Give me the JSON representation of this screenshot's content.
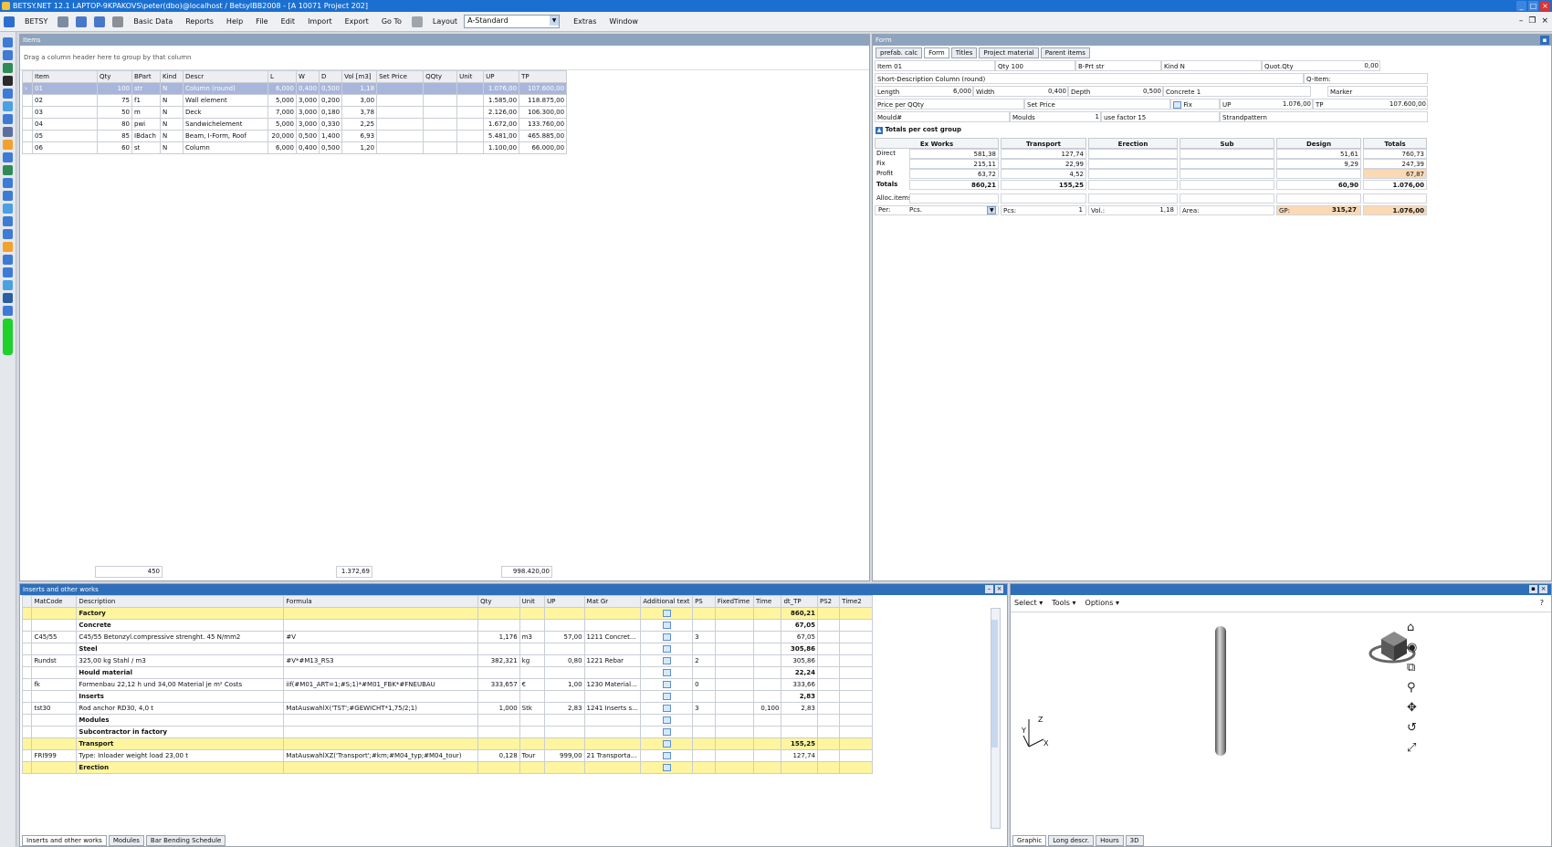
{
  "app": {
    "title": "BETSY.NET 12.1  LAPTOP-9KPAKOVS\\peter(dbo)@localhost / BetsyIBB2008 - [A 10071 Project 202]",
    "brand_color": "#1b6fd1"
  },
  "menu": {
    "items": [
      "BETSY",
      "Basic Data",
      "Reports",
      "Help",
      "File",
      "Edit",
      "Import",
      "Export",
      "Go To",
      "Layout",
      "Extras",
      "Window"
    ],
    "layout_value": "A-Standard"
  },
  "items_panel": {
    "title": "Items",
    "group_hint": "Drag a column header here to group by that column",
    "columns": [
      "Item",
      "Qty",
      "BPart",
      "Kind",
      "Descr",
      "L",
      "W",
      "D",
      "Vol [m3]",
      "Set Price",
      "QQty",
      "Unit",
      "UP",
      "TP"
    ],
    "rows": [
      [
        "01",
        "100",
        "str",
        "N",
        "Column (round)",
        "6,000",
        "0,400",
        "0,500",
        "1,18",
        "",
        "",
        "",
        "1.076,00",
        "107.600,00"
      ],
      [
        "02",
        "75",
        "f1",
        "N",
        "Wall element",
        "5,000",
        "3,000",
        "0,200",
        "3,00",
        "",
        "",
        "",
        "1.585,00",
        "118.875,00"
      ],
      [
        "03",
        "50",
        "m",
        "N",
        "Deck",
        "7,000",
        "3,000",
        "0,180",
        "3,78",
        "",
        "",
        "",
        "2.126,00",
        "106.300,00"
      ],
      [
        "04",
        "80",
        "pwi",
        "N",
        "Sandwichelement",
        "5,000",
        "3,000",
        "0,330",
        "2,25",
        "",
        "",
        "",
        "1.672,00",
        "133.760,00"
      ],
      [
        "05",
        "85",
        "IBdach",
        "N",
        "Beam, I-Form, Roof",
        "20,000",
        "0,500",
        "1,400",
        "6,93",
        "",
        "",
        "",
        "5.481,00",
        "465.885,00"
      ],
      [
        "06",
        "60",
        "st",
        "N",
        "Column",
        "6,000",
        "0,400",
        "0,500",
        "1,20",
        "",
        "",
        "",
        "1.100,00",
        "66.000,00"
      ]
    ],
    "totals": {
      "qty": "450",
      "vol": "1.372,69",
      "tp": "998.420,00"
    }
  },
  "form_panel": {
    "title": "Form",
    "tabs": [
      "prefab. calc",
      "Form",
      "Titles",
      "Project material",
      "Parent items"
    ],
    "fields": {
      "item": "Item  01",
      "qty": "Qty  100",
      "bprt": "B-Prt  str",
      "kind": "Kind  N",
      "quot_qty_label": "Quot.Qty",
      "quot_qty_val": "0,00",
      "short_desc": "Short-Description  Column (round)",
      "q_item": "Q-Item:",
      "length_label": "Length",
      "length_val": "6,000",
      "width_label": "Width",
      "width_val": "0,400",
      "depth_label": "Depth",
      "depth_val": "0,500",
      "concrete": "Concrete 1",
      "marker": "Marker",
      "price_per_qqty": "Price per QQty",
      "set_price": "Set Price",
      "fix": "Fix",
      "up_label": "UP",
      "up_val": "1.076,00",
      "tp_label": "TP",
      "tp_val": "107.600,00",
      "mould": "Mould#",
      "moulds_label": "Moulds",
      "moulds_val": "1",
      "use_factor": "use factor  15",
      "strandpattern": "Strandpattern"
    },
    "totals_title": "Totals per cost group",
    "group_headers": [
      "Ex Works",
      "Transport",
      "Erection",
      "Sub",
      "Design",
      "Totals"
    ],
    "row_labels": [
      "Direct",
      "Fix",
      "Profit",
      "Totals",
      "Alloc.items"
    ],
    "exworks": [
      "581,38",
      "215,11",
      "63,72",
      "860,21"
    ],
    "transport": [
      "127,74",
      "22,99",
      "4,52",
      "155,25"
    ],
    "design": [
      "51,61",
      "9,29",
      "",
      "60,90"
    ],
    "totals_col": [
      "760,73",
      "247,39",
      "67,87",
      "1.076,00"
    ],
    "per_label": "Per:",
    "per_val": "Pcs.",
    "pcs": "Pcs:",
    "pcs_val": "1",
    "vol": "Vol.:",
    "vol_val": "1,18",
    "area": "Area:",
    "gp": "GP:",
    "gp_val": "315,27",
    "gp_total": "1.076,00"
  },
  "inserts_panel": {
    "title": "Inserts and other works",
    "columns": [
      "MatCode",
      "Description",
      "Formula",
      "Qty",
      "Unit",
      "UP",
      "Mat Gr",
      "Additional text",
      "PS",
      "FixedTime",
      "Time",
      "dt_TP",
      "PS2",
      "Time2"
    ],
    "rows": [
      {
        "t": "y",
        "c": [
          "",
          "Factory",
          "",
          "",
          "",
          "",
          "",
          "",
          "",
          "",
          "",
          "860,21",
          "",
          ""
        ]
      },
      {
        "t": "b",
        "c": [
          "",
          "Concrete",
          "",
          "",
          "",
          "",
          "",
          "",
          "",
          "",
          "",
          "67,05",
          "",
          ""
        ]
      },
      {
        "t": "n",
        "c": [
          "C45/55",
          "C45/55 Betonzyl.compressive strenght.  45 N/mm2",
          "#V",
          "1,176",
          "m3",
          "57,00",
          "1211 Concret...",
          "",
          "3",
          "",
          "",
          "67,05",
          "",
          ""
        ]
      },
      {
        "t": "b",
        "c": [
          "",
          "Steel",
          "",
          "",
          "",
          "",
          "",
          "",
          "",
          "",
          "",
          "305,86",
          "",
          ""
        ]
      },
      {
        "t": "n",
        "c": [
          "Rundst",
          "325,00 kg Stahl / m3",
          "#V*#M13_RS3",
          "382,321",
          "kg",
          "0,80",
          "1221 Rebar",
          "",
          "2",
          "",
          "",
          "305,86",
          "",
          ""
        ]
      },
      {
        "t": "b",
        "c": [
          "",
          "Hould material",
          "",
          "",
          "",
          "",
          "",
          "",
          "",
          "",
          "",
          "22,24",
          "",
          ""
        ]
      },
      {
        "t": "n",
        "c": [
          "fk",
          "Formenbau 22,12 h und 34,00 Material je m² Costs",
          "iif(#M01_ART=1;#S;1)*#M01_FBK*#FNEUBAU",
          "333,657",
          "€",
          "1,00",
          "1230 Material...",
          "",
          "0",
          "",
          "",
          "333,66",
          "",
          ""
        ]
      },
      {
        "t": "b",
        "c": [
          "",
          "Inserts",
          "",
          "",
          "",
          "",
          "",
          "",
          "",
          "",
          "",
          "2,83",
          "",
          ""
        ]
      },
      {
        "t": "n",
        "c": [
          "tst30",
          "Rod anchor RD30, 4,0 t",
          "MatAuswahlX('TST';#GEWICHT*1,75/2;1)",
          "1,000",
          "Stk",
          "2,83",
          "1241 Inserts s...",
          "",
          "3",
          "",
          "0,100",
          "2,83",
          "",
          ""
        ]
      },
      {
        "t": "b",
        "c": [
          "",
          "Modules",
          "",
          "",
          "",
          "",
          "",
          "",
          "",
          "",
          "",
          "",
          "",
          ""
        ]
      },
      {
        "t": "b",
        "c": [
          "",
          "Subcontractor in factory",
          "",
          "",
          "",
          "",
          "",
          "",
          "",
          "",
          "",
          "",
          "",
          ""
        ]
      },
      {
        "t": "y",
        "c": [
          "",
          "Transport",
          "",
          "",
          "",
          "",
          "",
          "",
          "",
          "",
          "",
          "155,25",
          "",
          ""
        ]
      },
      {
        "t": "n",
        "c": [
          "FRI999",
          "Type: Inloader weight load 23,00 t",
          "MatAuswahlXZ('Transport';#km;#M04_typ;#M04_tour)",
          "0,128",
          "Tour",
          "999,00",
          "21 Transporta...",
          "",
          "",
          "",
          "",
          "127,74",
          "",
          ""
        ]
      },
      {
        "t": "y",
        "c": [
          "",
          "Erection",
          "",
          "",
          "",
          "",
          "",
          "",
          "",
          "",
          "",
          "",
          "",
          ""
        ]
      }
    ],
    "bottom_tabs": [
      "Inserts and other works",
      "Modules",
      "Bar Bending Schedule"
    ]
  },
  "graphic_panel": {
    "menu": [
      "Select",
      "Tools",
      "Options"
    ],
    "help": "?",
    "axis_z": "Z",
    "axis_y": "Y",
    "axis_x": "X",
    "bottom_tabs": [
      "Graphic",
      "Long descr.",
      "Hours",
      "3D"
    ]
  }
}
